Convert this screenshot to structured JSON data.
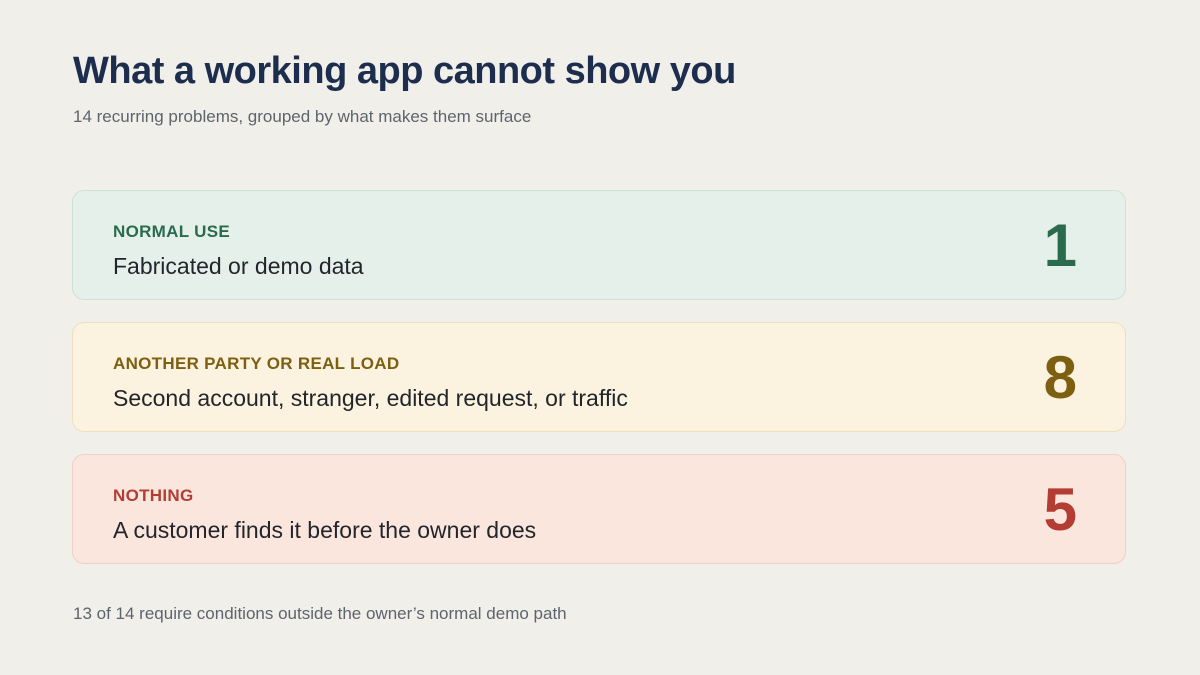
{
  "header": {
    "title": "What a working app cannot show you",
    "subtitle": "14 recurring problems, grouped by what makes them surface"
  },
  "groups": [
    {
      "label": "NORMAL USE",
      "description": "Fabricated or demo data",
      "count": "1",
      "accent_color": "#2a6b4e",
      "background_color": "#e6f0ea"
    },
    {
      "label": "ANOTHER PARTY OR REAL LOAD",
      "description": "Second account, stranger, edited request, or traffic",
      "count": "8",
      "accent_color": "#7d5f12",
      "background_color": "#fbf2df"
    },
    {
      "label": "NOTHING",
      "description": "A customer finds it before the owner does",
      "count": "5",
      "accent_color": "#b33c33",
      "background_color": "#fbe6de"
    }
  ],
  "footer": {
    "note": "13 of 14 require conditions outside the owner’s normal demo path"
  }
}
